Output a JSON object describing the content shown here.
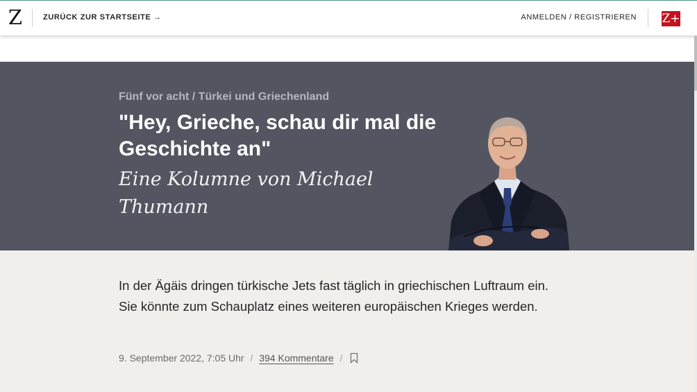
{
  "header": {
    "logo": "Z",
    "back_link": "ZURÜCK ZUR STARTSEITE →",
    "login": "ANMELDEN / REGISTRIEREN",
    "zplus": "Z+",
    "zplus_color": "#c1121f"
  },
  "article": {
    "kicker": "Fünf vor acht / Türkei und Griechenland",
    "headline": "\"Hey, Grieche, schau dir mal die Geschichte an\"",
    "byline": "Eine Kolumne von Michael Thumann",
    "summary": "In der Ägäis dringen türkische Jets fast täglich in griechischen Luftraum ein. Sie könnte zum Schauplatz eines weiteren europäischen Krieges werden.",
    "date": "9. September 2022, 7:05 Uhr",
    "separator": "/",
    "comments": "394 Kommentare",
    "bookmark_icon": "bookmark-icon"
  },
  "colors": {
    "hero_bg": "#535661",
    "body_bg": "#f0efec"
  }
}
